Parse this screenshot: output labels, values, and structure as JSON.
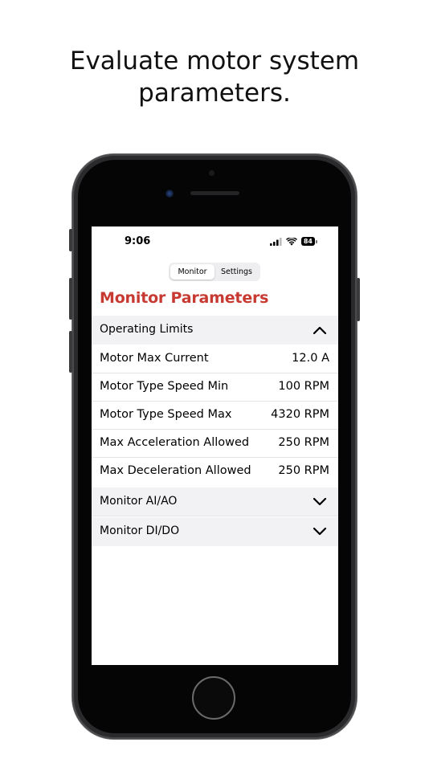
{
  "headline": {
    "line1": "Evaluate motor system",
    "line2": "parameters."
  },
  "status_bar": {
    "time": "9:06",
    "battery": "84",
    "icons": [
      "signal-icon",
      "wifi-icon",
      "battery-icon"
    ]
  },
  "tabs": [
    {
      "label": "Monitor",
      "selected": true
    },
    {
      "label": "Settings",
      "selected": false
    }
  ],
  "page": {
    "title": "Monitor Parameters"
  },
  "sections": [
    {
      "label": "Operating Limits",
      "expanded": true,
      "rows": [
        {
          "label": "Motor Max Current",
          "value": "12.0 A"
        },
        {
          "label": "Motor Type Speed Min",
          "value": "100 RPM"
        },
        {
          "label": "Motor Type Speed Max",
          "value": "4320 RPM"
        },
        {
          "label": "Max Acceleration Allowed",
          "value": "250 RPM"
        },
        {
          "label": "Max Deceleration Allowed",
          "value": "250 RPM"
        }
      ]
    },
    {
      "label": "Monitor AI/AO",
      "expanded": false
    },
    {
      "label": "Monitor DI/DO",
      "expanded": false
    }
  ],
  "colors": {
    "accent": "#c73a32",
    "section_bg": "#f2f2f5"
  }
}
